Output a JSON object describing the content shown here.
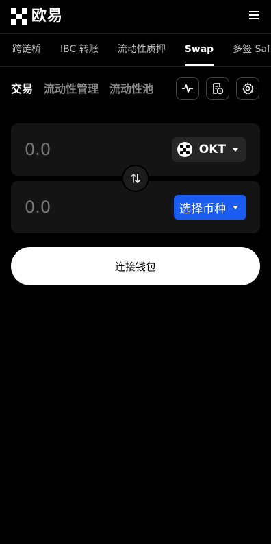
{
  "brand": {
    "name": "欧易"
  },
  "nav": {
    "items": [
      {
        "label": "跨链桥",
        "active": false
      },
      {
        "label": "IBC 转账",
        "active": false
      },
      {
        "label": "流动性质押",
        "active": false
      },
      {
        "label": "Swap",
        "active": true
      },
      {
        "label": "多签 Safe",
        "active": false
      }
    ]
  },
  "sub_tabs": [
    {
      "label": "交易",
      "active": true
    },
    {
      "label": "流动性管理",
      "active": false
    },
    {
      "label": "流动性池",
      "active": false
    }
  ],
  "tools": [
    {
      "icon": "activity-icon"
    },
    {
      "icon": "history-icon"
    },
    {
      "icon": "gear-icon"
    }
  ],
  "from": {
    "amount": "0.0",
    "token": "OKT"
  },
  "to": {
    "amount": "0.0",
    "select_label": "选择币种"
  },
  "connect_label": "连接钱包",
  "colors": {
    "accent": "#1a5cf0",
    "card": "#141414",
    "background": "#000000"
  }
}
